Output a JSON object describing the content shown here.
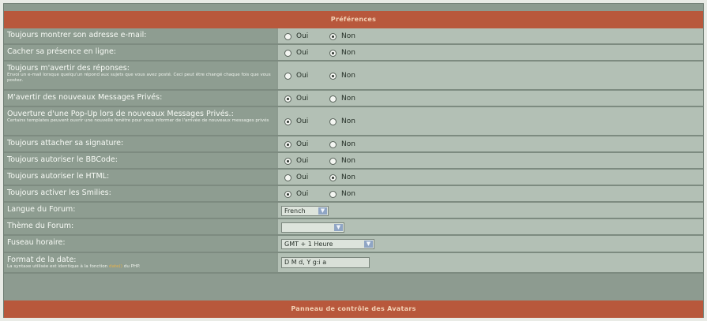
{
  "panel": {
    "title": "Préférences",
    "footer_title": "Panneau de contrôle des Avatars"
  },
  "options": {
    "yes": "Oui",
    "no": "Non"
  },
  "rows": [
    {
      "label": "Toujours montrer son adresse e-mail:",
      "value": "Non"
    },
    {
      "label": "Cacher sa présence en ligne:",
      "value": "Non"
    },
    {
      "label": "Toujours m'avertir des réponses:",
      "desc": "Envoi un e-mail lorsque quelqu'un répond aux sujets que vous avez posté. Ceci peut être changé chaque fois que vous postez.",
      "value": "Non"
    },
    {
      "label": "M'avertir des nouveaux Messages Privés:",
      "value": "Oui"
    },
    {
      "label": "Ouverture d'une Pop-Up lors de nouveaux Messages Privés.:",
      "desc": "Certains templates peuvent ouvrir une nouvelle fenêtre pour vous informer de l'arrivée de nouveaux messages privés",
      "value": "Oui"
    },
    {
      "label": "Toujours attacher sa signature:",
      "value": "Oui"
    },
    {
      "label": "Toujours autoriser le BBCode:",
      "value": "Oui"
    },
    {
      "label": "Toujours autoriser le HTML:",
      "value": "Non"
    },
    {
      "label": "Toujours activer les Smilies:",
      "value": "Oui"
    }
  ],
  "language": {
    "label": "Langue du Forum:",
    "value": "French"
  },
  "theme": {
    "label": "Thème du Forum:",
    "value": ""
  },
  "timezone": {
    "label": "Fuseau horaire:",
    "value": "GMT + 1 Heure"
  },
  "dateformat": {
    "label": "Format de la date:",
    "desc_before": "La syntaxe utilisée est identique à la fonction",
    "desc_link": "date()",
    "desc_after": "du PHP.",
    "value": "D M d, Y g:i a"
  }
}
